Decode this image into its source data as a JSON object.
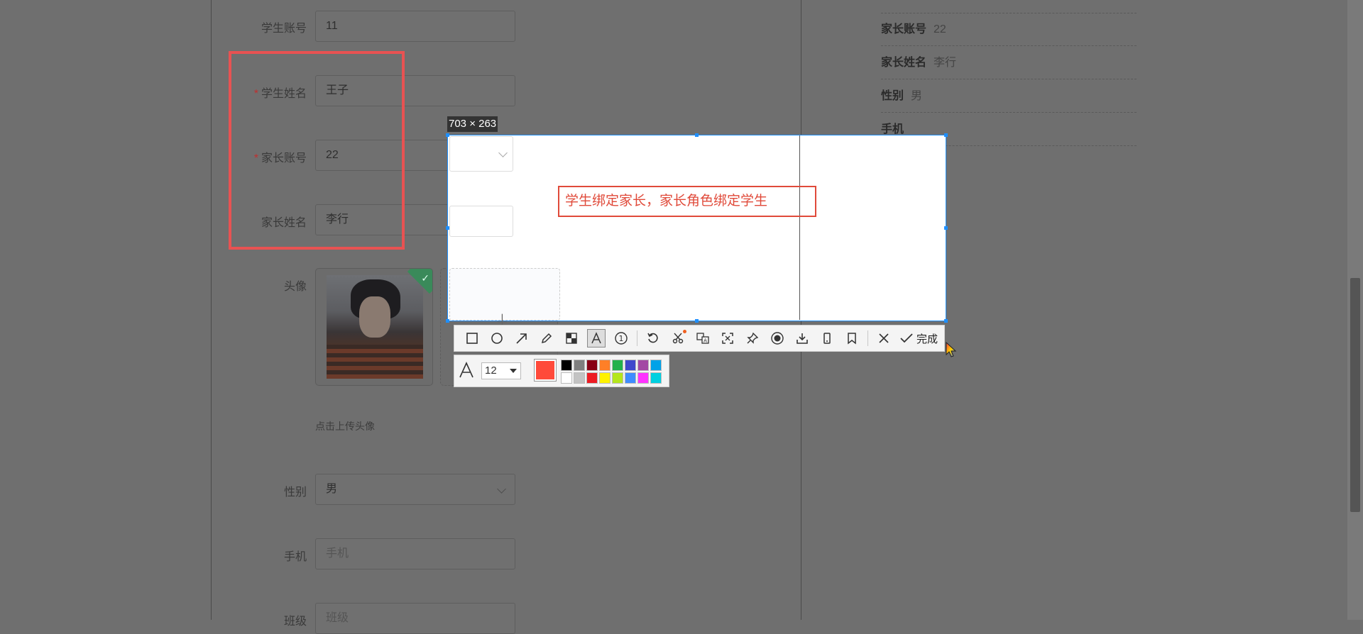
{
  "form": {
    "student_account": {
      "label": "学生账号",
      "value": "11"
    },
    "student_name": {
      "label": "学生姓名",
      "value": "王子",
      "required": true
    },
    "parent_account": {
      "label": "家长账号",
      "value": "22",
      "required": true
    },
    "parent_name": {
      "label": "家长姓名",
      "value": "李行"
    },
    "avatar": {
      "label": "头像",
      "hint": "点击上传头像"
    },
    "gender": {
      "label": "性别",
      "value": "男"
    },
    "phone": {
      "label": "手机",
      "placeholder": "手机"
    },
    "class": {
      "label": "班级",
      "placeholder": "班级"
    }
  },
  "detail": {
    "items": [
      {
        "key": "家长账号",
        "value": "22"
      },
      {
        "key": "家长姓名",
        "value": "李行"
      },
      {
        "key": "性别",
        "value": "男"
      },
      {
        "key": "手机",
        "value": ""
      }
    ]
  },
  "capture": {
    "size_label": "703 × 263",
    "annotation_text": "学生绑定家长，家长角色绑定学生"
  },
  "toolbar": {
    "done_label": "完成",
    "font_size": "12",
    "current_color": "#ff4a3a",
    "palette_top": [
      "#000000",
      "#7f7f7f",
      "#880015",
      "#ff7f27",
      "#22b14c",
      "#3f48cc",
      "#a349a4",
      "#00a2e8"
    ],
    "palette_bottom": [
      "#ffffff",
      "#c3c3c3",
      "#ed1c24",
      "#fff200",
      "#b5e61d",
      "#3f8cff",
      "#ff33ff",
      "#00d0e0"
    ]
  },
  "colors": {
    "highlight_frame": "#e85252",
    "capture_border": "#1e8fff",
    "annotation": "#e04a3a"
  }
}
